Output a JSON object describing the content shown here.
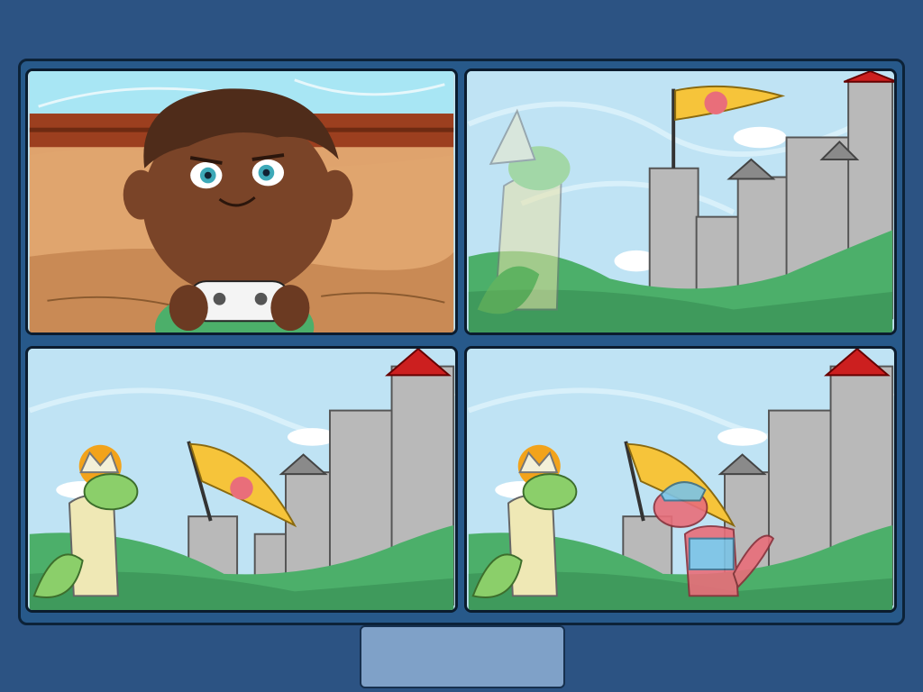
{
  "comic": {
    "panels": [
      {
        "scene": "boy-playing-game"
      },
      {
        "scene": "wizard-dinosaur-fading"
      },
      {
        "scene": "king-dinosaur-castle"
      },
      {
        "scene": "knight-dinosaur-appears"
      }
    ]
  },
  "controls": {
    "next_label": ""
  },
  "colors": {
    "page_bg": "#2c5383",
    "frame_border": "#0c2238",
    "button_bg": "#7fa1c8"
  }
}
